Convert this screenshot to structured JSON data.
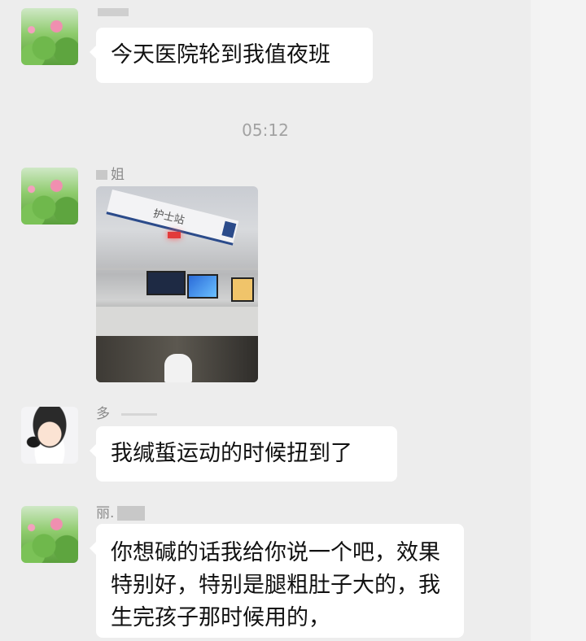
{
  "messages": [
    {
      "sender": "",
      "text": "今天医院轮到我值夜班"
    },
    {
      "sender": "姐",
      "text": ""
    },
    {
      "sender": "多",
      "text": "我缄蜇运动的时候扭到了"
    },
    {
      "sender": "丽.",
      "text": "你想碱的话我给你说一个吧，效果特别好，特别是腿粗肚子大的，我生完孩子那时候用的，"
    }
  ],
  "timestamp": "05:12",
  "photo": {
    "sign_text": "护士站"
  },
  "icons": [
    "lotus-avatar",
    "baby-avatar",
    "photo-thumbnail"
  ]
}
